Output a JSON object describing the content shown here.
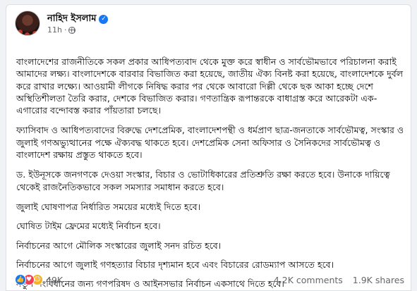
{
  "post": {
    "author": "নাহিদ ইসলাম",
    "time": "11h",
    "separator": "·",
    "paragraphs": [
      "বাংলাদেশের রাজনীতিকে সকল প্রকার আধিপত্যবাদ থেকে মুক্ত করে স্বাধীন ও সার্বভৌমভাবে পরিচালনা করাই আমাদের লক্ষ্য। বাংলাদেশকে বারবার বিভাজিত করা হয়েছে, জাতীয় ঐক্য বিনষ্ট করা হয়েছে, বাংলাদেশকে দুর্বল করে রাখার লক্ষ্যে। আওয়ামী লীগকে নিষিদ্ধ করার পর থেকে আবারো দিল্লী থেকে ছক আকা হচ্ছে দেশে অস্থিতিশীলতা তৈরি করার, দেশকে বিভাজিত করার। গণতান্ত্রিক রূপান্তরকে বাধাগ্রস্ত করে আরেকটা এক-এগারোর বন্দোবস্ত করার পাঁয়তারা চলছে।",
      "ফ্যাসিবাদ ও আধিপত্যবাদের বিরুদ্ধে দেশপ্রেমিক, বাংলাদেশপন্থী ও ধর্মপ্রাণ ছাত্র-জনতাকে সার্বভৌমত্ব, সংস্কার ও জুলাই গণঅভ্যুত্থানের পক্ষে ঐক্যবদ্ধ থাকতে হবে। দেশপ্রেমিক সেনা অফিসার ও সৈনিকদের সার্বভৌমত্ব ও বাংলাদেশ রক্ষায় প্রস্তুত থাকতে হবে।",
      "ড. ইউনূসকে জনগণকে দেওয়া সংস্কার, বিচার ও ভোটাধিকারের প্রতিশ্রুতি রক্ষা করতে হবে। উনাকে দায়িত্বে থেকেই রাজনৈতিকভাবে সকল সমস্যার সমাধান করতে হবে।",
      "জুলাই ঘোষণাপত্র নির্ধারিত সময়ের মধ্যেই দিতে হবে।",
      "ঘোষিত টাইম ফ্রেমের মধ্যেই নির্বাচন হবে।",
      "নির্বাচনের আগে মৌলিক সংস্কারের জুলাই সনদ রচিত হবে।",
      "নির্বাচনের আগে জুলাই গণহত্যার বিচার দৃশ্যমান হবে এবং বিচারের রোডম্যাপ আসতে হবে।",
      "নতুন সংবিধানের জন্য গণপরিষদ ও আইনসভার নির্বাচন একসাথে দিতে হবে।"
    ]
  },
  "stats": {
    "reactions": "49K",
    "comments": "4.2K comments",
    "shares": "1.9K shares"
  },
  "icons": {
    "verified": "verified-badge-icon",
    "audience": "globe-icon",
    "like": "like-reaction-icon",
    "love": "love-reaction-icon",
    "care": "care-reaction-icon"
  },
  "colors": {
    "accent": "#1877f2",
    "love": "#f33e58",
    "care": "#f7b125",
    "meta": "#65676b"
  }
}
